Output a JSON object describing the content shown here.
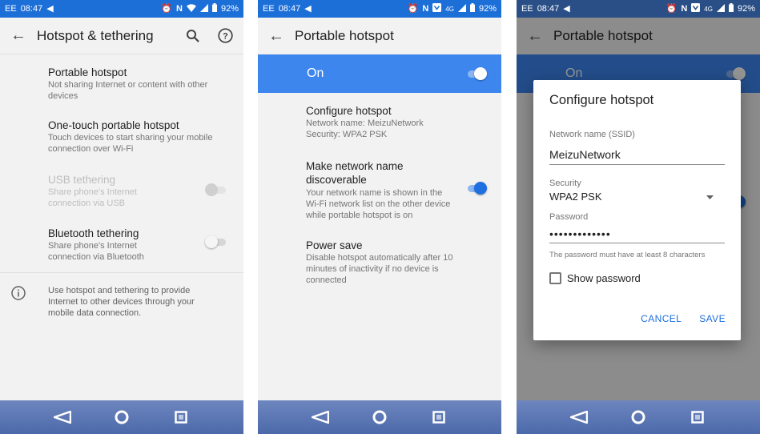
{
  "status_bar": {
    "carrier": "EE",
    "time": "08:47",
    "network_badge": "4G",
    "battery": "92%",
    "icons": [
      "navigation-arrow-icon",
      "alarm-icon",
      "nfc-icon",
      "wifi-icon",
      "hotspot-icon",
      "signal-icon",
      "battery-icon"
    ]
  },
  "screen1": {
    "title": "Hotspot & tethering",
    "items": [
      {
        "title": "Portable hotspot",
        "subtitle": "Not sharing Internet or content with other devices"
      },
      {
        "title": "One-touch portable hotspot",
        "subtitle": "Touch devices to start sharing your mobile connection over Wi-Fi"
      },
      {
        "title": "USB tethering",
        "subtitle": "Share phone's Internet connection via USB",
        "enabled": false,
        "checked": false
      },
      {
        "title": "Bluetooth tethering",
        "subtitle": "Share phone's Internet connection via Bluetooth",
        "enabled": true,
        "checked": false
      }
    ],
    "info_text": "Use hotspot and tethering to provide Internet to other devices through your mobile data connection."
  },
  "screen2": {
    "title": "Portable hotspot",
    "master_switch": {
      "label": "On",
      "checked": true
    },
    "items": [
      {
        "title": "Configure hotspot",
        "subtitle": "Network name: MeizuNetwork\nSecurity: WPA2 PSK"
      },
      {
        "title": "Make network name discoverable",
        "subtitle": "Your network name is shown in the Wi-Fi network list on the other device while portable hotspot is on",
        "checked": true
      },
      {
        "title": "Power save",
        "subtitle": "Disable hotspot automatically after 10 minutes of inactivity if no device is connected"
      }
    ]
  },
  "screen3": {
    "title": "Portable hotspot",
    "background_switch_label": "On",
    "dialog": {
      "title": "Configure hotspot",
      "ssid_label": "Network name (SSID)",
      "ssid_value": "MeizuNetwork",
      "security_label": "Security",
      "security_value": "WPA2 PSK",
      "password_label": "Password",
      "password_value": "•••••••••••••",
      "password_hint": "The password must have at least 8 characters",
      "show_password_label": "Show password",
      "show_password_checked": false,
      "cancel_label": "CANCEL",
      "save_label": "SAVE"
    }
  },
  "colors": {
    "status_bar": "#1d6fd8",
    "accent": "#1f6fe0",
    "switch_bar": "#3d86ee",
    "nav_bar": "#5670b0"
  }
}
